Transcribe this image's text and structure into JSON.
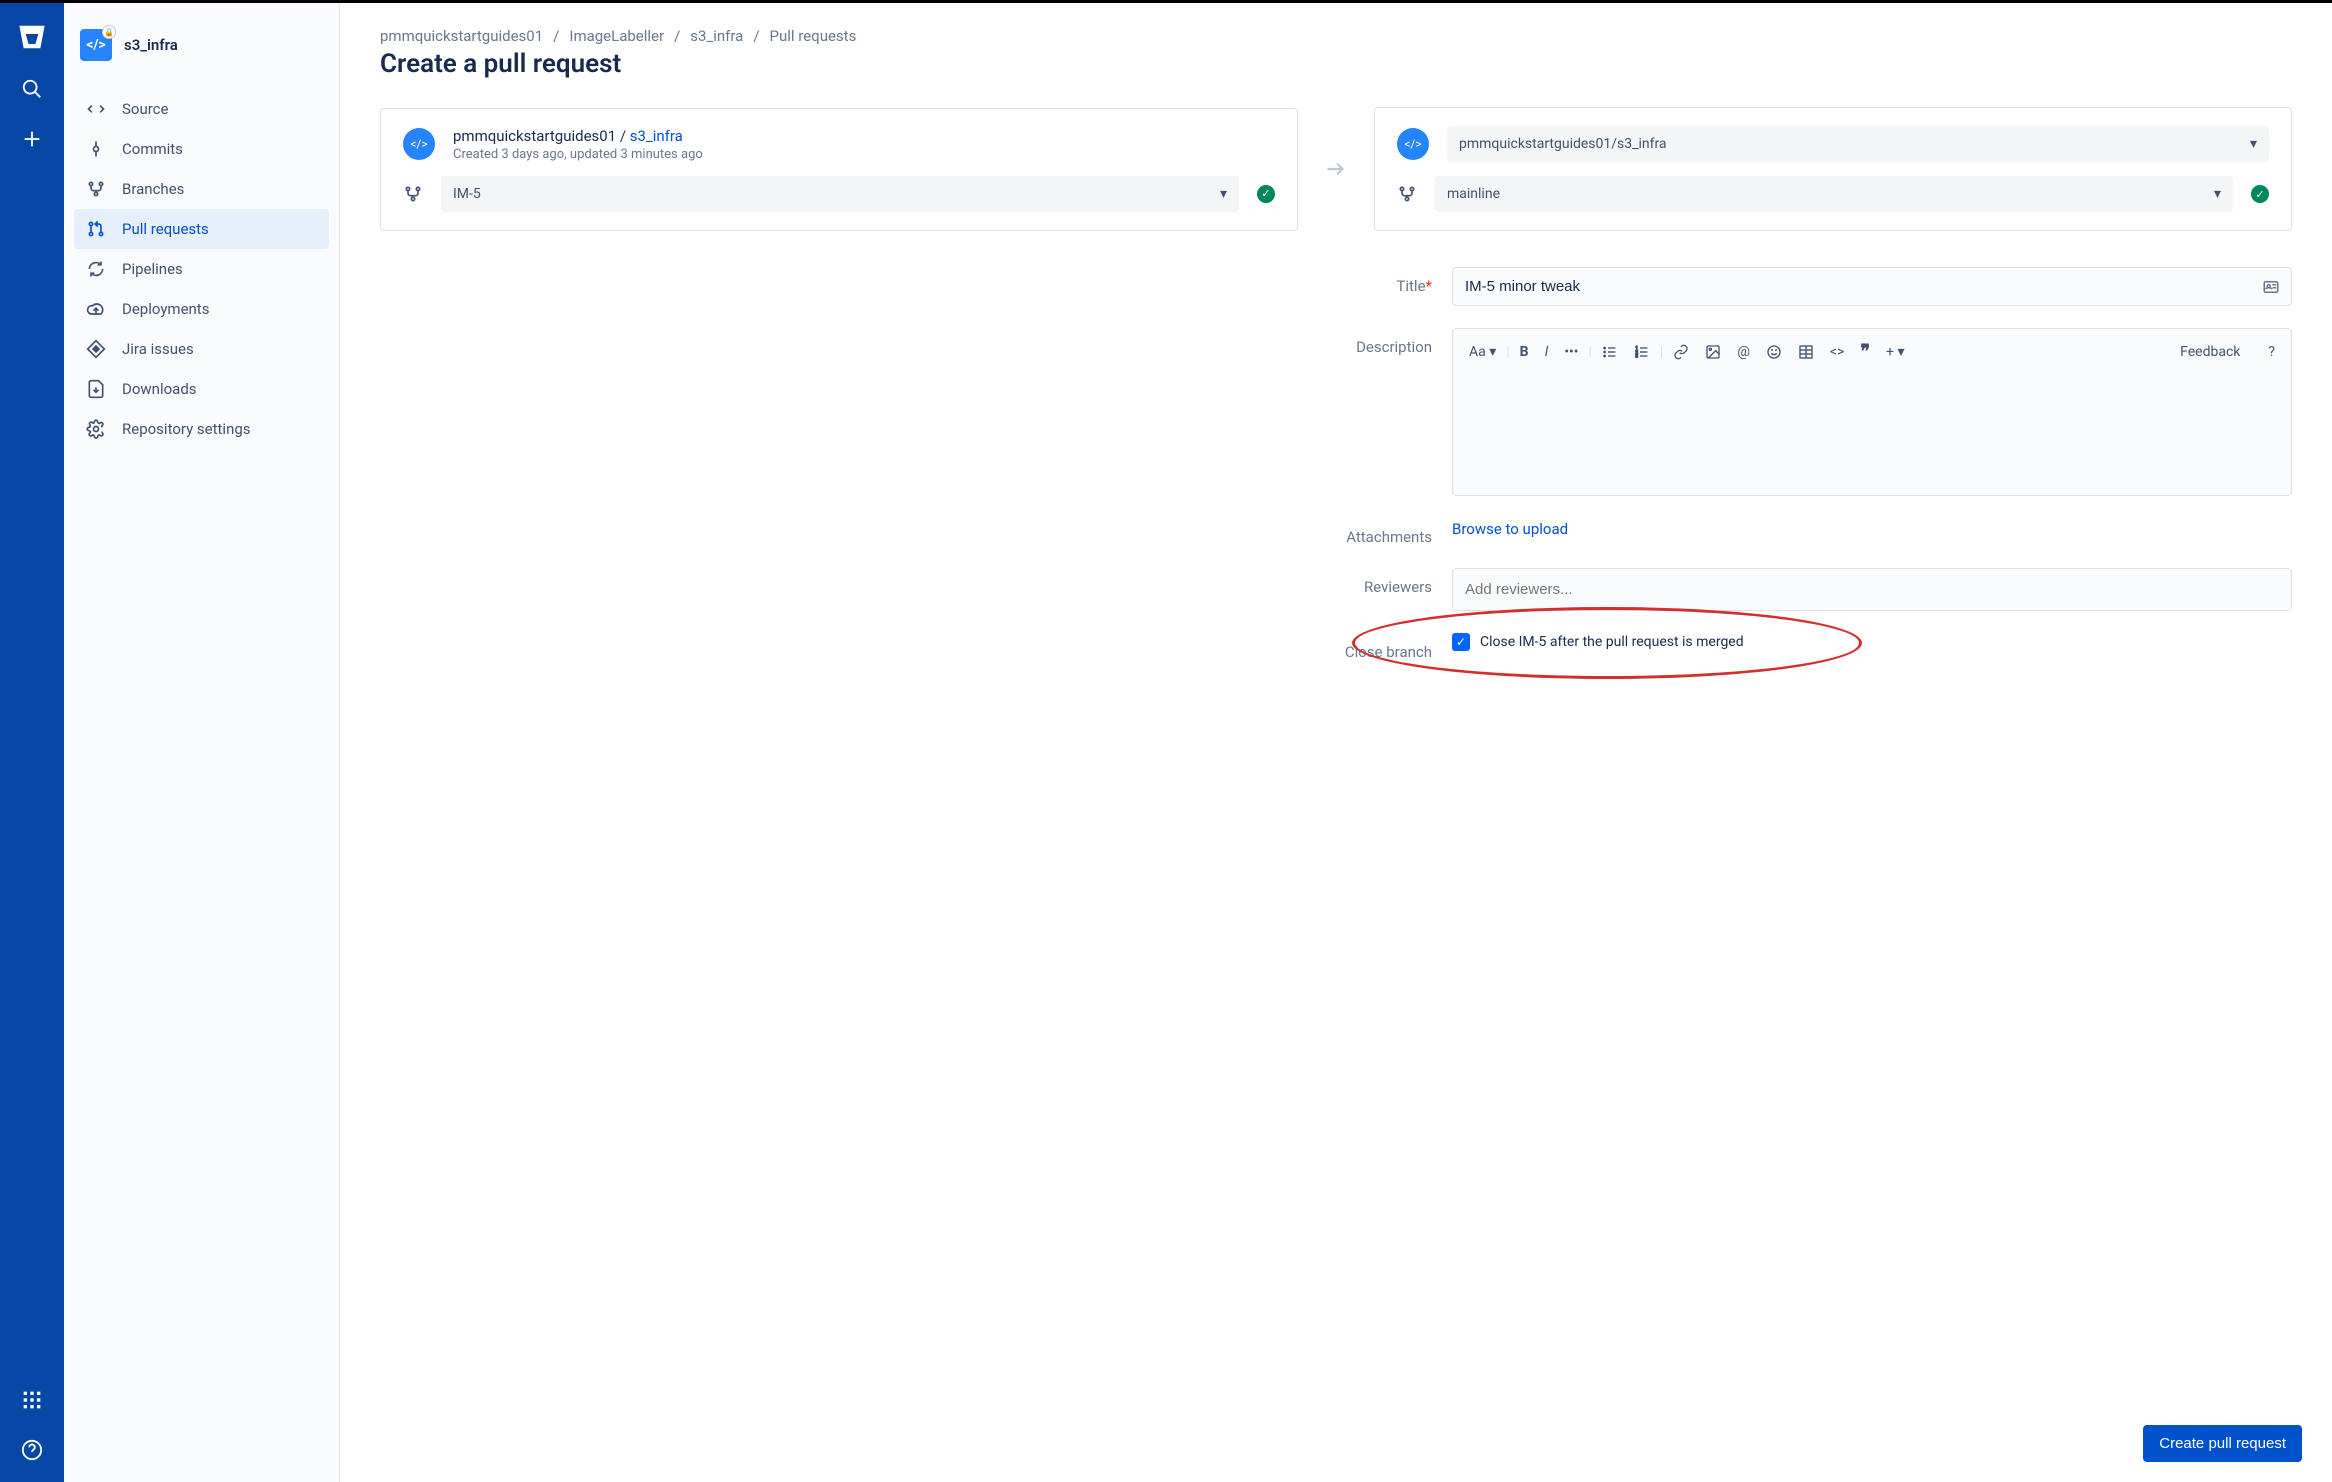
{
  "repo_name": "s3_infra",
  "breadcrumb": [
    "pmmquickstartguides01",
    "ImageLabeller",
    "s3_infra",
    "Pull requests"
  ],
  "page_title": "Create a pull request",
  "nav": {
    "items": [
      {
        "label": "Source"
      },
      {
        "label": "Commits"
      },
      {
        "label": "Branches"
      },
      {
        "label": "Pull requests"
      },
      {
        "label": "Pipelines"
      },
      {
        "label": "Deployments"
      },
      {
        "label": "Jira issues"
      },
      {
        "label": "Downloads"
      },
      {
        "label": "Repository settings"
      }
    ],
    "active_index": 3
  },
  "source_box": {
    "owner": "pmmquickstartguides01",
    "repo": "s3_infra",
    "meta": "Created 3 days ago, updated 3 minutes ago",
    "branch": "IM-5",
    "build_ok": true
  },
  "dest_box": {
    "repo_full": "pmmquickstartguides01/s3_infra",
    "branch": "mainline",
    "build_ok": true
  },
  "form": {
    "title_label": "Title",
    "title_value": "IM-5 minor tweak",
    "description_label": "Description",
    "toolbar_text_style": "Aa",
    "feedback": "Feedback",
    "attachments_label": "Attachments",
    "browse": "Browse to upload",
    "reviewers_label": "Reviewers",
    "reviewers_placeholder": "Add reviewers...",
    "close_branch_label": "Close branch",
    "close_branch_text": "Close IM-5 after the pull request is merged",
    "close_branch_checked": true
  },
  "create_button": "Create pull request"
}
